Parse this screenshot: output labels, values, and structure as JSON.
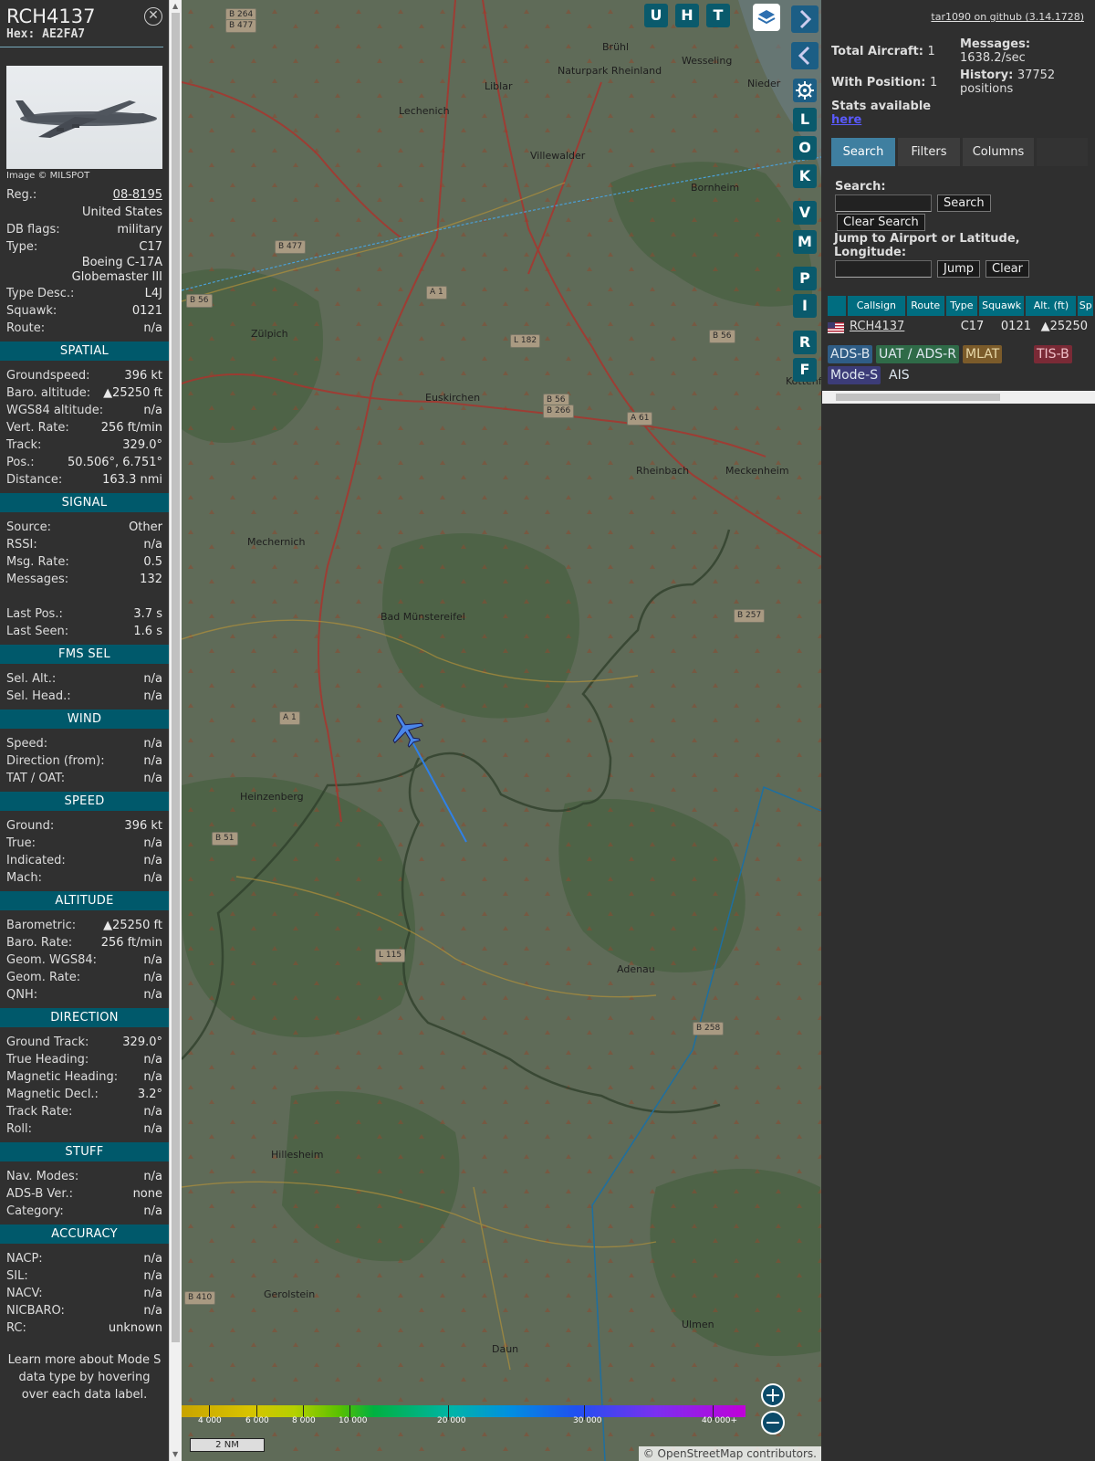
{
  "aircraft": {
    "callsign": "RCH4137",
    "hex_label": "Hex:",
    "hex": "AE2FA7",
    "photo_credit": "Image © MILSPOT"
  },
  "details": [
    {
      "k": "Reg.:",
      "v": "08-8195",
      "link": true
    },
    {
      "k": "",
      "v": "United States"
    },
    {
      "k": "DB flags:",
      "v": "military"
    },
    {
      "k": "Type:",
      "v": "C17"
    },
    {
      "k": "",
      "v": "Boeing C-17A Globemaster III",
      "wrap": true
    },
    {
      "k": "Type Desc.:",
      "v": "L4J"
    },
    {
      "k": "Squawk:",
      "v": "0121"
    },
    {
      "k": "Route:",
      "v": "n/a"
    }
  ],
  "sections": [
    {
      "title": "SPATIAL",
      "rows": [
        [
          "Groundspeed:",
          "396 kt"
        ],
        [
          "Baro. altitude:",
          "▲25250 ft"
        ],
        [
          "WGS84 altitude:",
          "n/a"
        ],
        [
          "Vert. Rate:",
          "256 ft/min"
        ],
        [
          "Track:",
          "329.0°"
        ],
        [
          "Pos.:",
          "50.506°, 6.751°"
        ],
        [
          "Distance:",
          "163.3 nmi"
        ]
      ]
    },
    {
      "title": "SIGNAL",
      "rows": [
        [
          "Source:",
          "Other"
        ],
        [
          "RSSI:",
          "n/a"
        ],
        [
          "Msg. Rate:",
          "0.5"
        ],
        [
          "Messages:",
          "132"
        ],
        [
          "",
          ""
        ],
        [
          "Last Pos.:",
          "3.7 s"
        ],
        [
          "Last Seen:",
          "1.6 s"
        ]
      ]
    },
    {
      "title": "FMS SEL",
      "rows": [
        [
          "Sel. Alt.:",
          "n/a"
        ],
        [
          "Sel. Head.:",
          "n/a"
        ]
      ]
    },
    {
      "title": "WIND",
      "rows": [
        [
          "Speed:",
          "n/a"
        ],
        [
          "Direction (from):",
          "n/a"
        ],
        [
          "TAT / OAT:",
          "n/a"
        ]
      ]
    },
    {
      "title": "SPEED",
      "rows": [
        [
          "Ground:",
          "396 kt"
        ],
        [
          "True:",
          "n/a"
        ],
        [
          "Indicated:",
          "n/a"
        ],
        [
          "Mach:",
          "n/a"
        ]
      ]
    },
    {
      "title": "ALTITUDE",
      "rows": [
        [
          "Barometric:",
          "▲25250 ft"
        ],
        [
          "Baro. Rate:",
          "256 ft/min"
        ],
        [
          "Geom. WGS84:",
          "n/a"
        ],
        [
          "Geom. Rate:",
          "n/a"
        ],
        [
          "QNH:",
          "n/a"
        ]
      ]
    },
    {
      "title": "DIRECTION",
      "rows": [
        [
          "Ground Track:",
          "329.0°"
        ],
        [
          "True Heading:",
          "n/a"
        ],
        [
          "Magnetic Heading:",
          "n/a"
        ],
        [
          "Magnetic Decl.:",
          "3.2°"
        ],
        [
          "Track Rate:",
          "n/a"
        ],
        [
          "Roll:",
          "n/a"
        ]
      ]
    },
    {
      "title": "STUFF",
      "rows": [
        [
          "Nav. Modes:",
          "n/a"
        ],
        [
          "ADS-B Ver.:",
          "none"
        ],
        [
          "Category:",
          "n/a"
        ]
      ]
    },
    {
      "title": "ACCURACY",
      "rows": [
        [
          "NACP:",
          "n/a"
        ],
        [
          "SIL:",
          "n/a"
        ],
        [
          "NACV:",
          "n/a"
        ],
        [
          "NICBARO:",
          "n/a"
        ],
        [
          "RC:",
          "unknown"
        ]
      ]
    }
  ],
  "learn_more": "Learn more about Mode S data type by hovering over each data label.",
  "map": {
    "places": [
      [
        "Brühl",
        461,
        52
      ],
      [
        "Wesseling",
        548,
        67
      ],
      [
        "Naturpark Rheinland",
        412,
        78
      ],
      [
        "Liblar",
        332,
        95
      ],
      [
        "Lechenich",
        238,
        122
      ],
      [
        "Nieder",
        620,
        92
      ],
      [
        "Bornheim",
        558,
        206
      ],
      [
        "Zülpich",
        76,
        366
      ],
      [
        "Euskirchen",
        267,
        436
      ],
      [
        "Rheinbach",
        498,
        516
      ],
      [
        "Meckenheim",
        596,
        516
      ],
      [
        "Mechernich",
        72,
        594
      ],
      [
        "Bad Münstereifel",
        218,
        676
      ],
      [
        "Heinzenberg",
        64,
        873
      ],
      [
        "Adenau",
        477,
        1062
      ],
      [
        "Hillesheim",
        98,
        1265
      ],
      [
        "Gerolstein",
        90,
        1418
      ],
      [
        "Daun",
        340,
        1478
      ],
      [
        "Ulmen",
        548,
        1451
      ],
      [
        "Kottenfo",
        662,
        418
      ],
      [
        "Villewalder",
        382,
        171
      ]
    ],
    "roads": [
      [
        "B 264",
        48,
        16
      ],
      [
        "B 477",
        48,
        28
      ],
      [
        "B 477",
        102,
        270
      ],
      [
        "B 56",
        5,
        329
      ],
      [
        "A 1",
        268,
        320
      ],
      [
        "L 182",
        360,
        373
      ],
      [
        "B 56",
        578,
        368
      ],
      [
        "B 56",
        396,
        438
      ],
      [
        "B 266",
        396,
        450
      ],
      [
        "A 61",
        488,
        458
      ],
      [
        "B 257",
        605,
        674
      ],
      [
        "A 1",
        107,
        786
      ],
      [
        "B 51",
        33,
        918
      ],
      [
        "L 115",
        212,
        1046
      ],
      [
        "B 258",
        560,
        1126
      ],
      [
        "B 410",
        3,
        1421
      ]
    ],
    "buttons_top": [
      "U",
      "H",
      "T"
    ],
    "buttons_side": [
      "L",
      "O",
      "K",
      "V",
      "M",
      "P",
      "I",
      "R",
      "F"
    ],
    "colorbar_ticks": [
      "4 000",
      "6 000",
      "8 000",
      "10 000",
      "20 000",
      "30 000",
      "40 000+"
    ],
    "scale": "2 NM",
    "attribution": "© OpenStreetMap contributors."
  },
  "right": {
    "github": "tar1090 on github (3.14.1728)",
    "total_label": "Total Aircraft:",
    "total": "1",
    "withpos_label": "With Position:",
    "withpos": "1",
    "messages_label": "Messages:",
    "messages": "1638.2/sec",
    "history_label": "History:",
    "history": "37752 positions",
    "stats_label": "Stats available",
    "stats_link": "here",
    "tabs": [
      "Search",
      "Filters",
      "Columns"
    ],
    "search_label": "Search:",
    "search_btn": "Search",
    "clear_search": "Clear Search",
    "jump_label": "Jump to Airport or Latitude, Longitude:",
    "jump_btn": "Jump",
    "clear_btn": "Clear",
    "columns": [
      "",
      "Callsign",
      "Route",
      "Type",
      "Squawk",
      "Alt. (ft)",
      "Sp"
    ],
    "row": {
      "callsign": "RCH4137",
      "route": "",
      "type": "C17",
      "squawk": "0121",
      "alt": "▲25250"
    },
    "legend": [
      [
        "ADS-B",
        "#2f5d86"
      ],
      [
        "UAT / ADS-R",
        "#2f6b48"
      ],
      [
        "MLAT",
        "#7b5b2a"
      ],
      [
        "TIS-B",
        "#7a2a36"
      ],
      [
        "Mode-S",
        "#3c3c78"
      ],
      [
        "AIS",
        "transparent"
      ]
    ]
  }
}
